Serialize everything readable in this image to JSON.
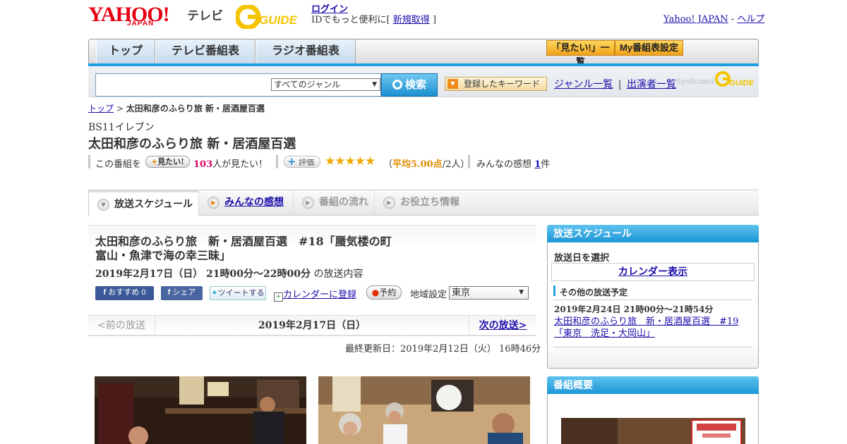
{
  "header": {
    "logo_yahoo": "YAHOO!",
    "logo_japan": "JAPAN",
    "logo_tv": "テレビ",
    "logo_gguide": "GUIDE",
    "login": "ログイン",
    "login_note_prefix": "IDでもっと便利に[",
    "signup": "新規取得",
    "login_note_suffix": "]",
    "yahoo_japan_link": "Yahoo! JAPAN",
    "separator": "-",
    "help_link": "ヘルプ"
  },
  "nav": {
    "tabs": [
      "トップ",
      "テレビ番組表",
      "ラジオ番組表"
    ],
    "mitai_list": "「見たい!」一覧",
    "my_schedule": "My番組表設定"
  },
  "search": {
    "genre_selected": "すべてのジャンル",
    "button": "検索",
    "keyword_button": "登録したキーワード",
    "genre_list": "ジャンル一覧",
    "divider": "|",
    "performer_list": "出演者一覧",
    "syndicated": "Syndicated",
    "gguide_small": "GUIDE"
  },
  "breadcrumb": {
    "top": "トップ",
    "sep": ">",
    "current": "太田和彦のふらり旅 新・居酒屋百選"
  },
  "program": {
    "channel": "BS11イレブン",
    "title": "太田和彦のふらり旅 新・居酒屋百選",
    "watch_prefix": "この番組を",
    "watch_button": "見たい!",
    "watch_count": "103",
    "watch_suffix": "人が見たい！",
    "rate_button": "評価",
    "stars": "★★★★★",
    "avg_open": "（",
    "avg_text": "平均5.00点",
    "avg_count": "/2人）",
    "reviews_label": "みんなの感想",
    "reviews_count": "1",
    "reviews_unit": "件"
  },
  "content_tabs": [
    "放送スケジュール",
    "みんなの感想",
    "番組の流れ",
    "お役立ち情報"
  ],
  "episode": {
    "title": "太田和彦のふらり旅　新・居酒屋百選　#18「蜃気楼の町　富山・魚津で海の幸三昧」",
    "datetime": "2019年2月17日（日）  21時00分～22時00分",
    "datetime_suffix": "の放送内容",
    "recommend": "おすすめ 0",
    "share": "シェア",
    "tweet": "ツイートする",
    "calendar": "カレンダーに登録",
    "reserve": "予約",
    "region_label": "地域設定",
    "region_value": "東京"
  },
  "pager": {
    "prev": "<前の放送",
    "current": "2019年2月17日（日）",
    "next": "次の放送>"
  },
  "updated": "最終更新日：2019年2月12日（火）  16時46分",
  "sidebar": {
    "schedule_title": "放送スケジュール",
    "select_date": "放送日を選択",
    "calendar_link": "カレンダー表示",
    "other_schedule": "その他の放送予定",
    "next_datetime": "2019年2月24日  21時00分～21時54分",
    "next_title": "太田和彦のふらり旅　新・居酒屋百選　#19「東京　洗足・大岡山」",
    "overview_title": "番組概要"
  },
  "colors": {
    "brand_red": "#e60012",
    "link_blue": "#1a0dab",
    "accent_blue": "#1e9fe0",
    "star_gold": "#f0a800",
    "count_pink": "#d6005f"
  }
}
